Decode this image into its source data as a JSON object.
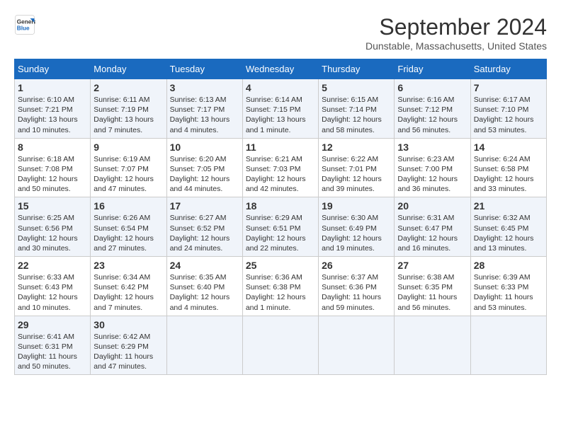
{
  "header": {
    "logo_line1": "General",
    "logo_line2": "Blue",
    "title": "September 2024",
    "subtitle": "Dunstable, Massachusetts, United States"
  },
  "columns": [
    "Sunday",
    "Monday",
    "Tuesday",
    "Wednesday",
    "Thursday",
    "Friday",
    "Saturday"
  ],
  "weeks": [
    [
      {
        "day": "1",
        "sunrise": "Sunrise: 6:10 AM",
        "sunset": "Sunset: 7:21 PM",
        "daylight": "Daylight: 13 hours and 10 minutes."
      },
      {
        "day": "2",
        "sunrise": "Sunrise: 6:11 AM",
        "sunset": "Sunset: 7:19 PM",
        "daylight": "Daylight: 13 hours and 7 minutes."
      },
      {
        "day": "3",
        "sunrise": "Sunrise: 6:13 AM",
        "sunset": "Sunset: 7:17 PM",
        "daylight": "Daylight: 13 hours and 4 minutes."
      },
      {
        "day": "4",
        "sunrise": "Sunrise: 6:14 AM",
        "sunset": "Sunset: 7:15 PM",
        "daylight": "Daylight: 13 hours and 1 minute."
      },
      {
        "day": "5",
        "sunrise": "Sunrise: 6:15 AM",
        "sunset": "Sunset: 7:14 PM",
        "daylight": "Daylight: 12 hours and 58 minutes."
      },
      {
        "day": "6",
        "sunrise": "Sunrise: 6:16 AM",
        "sunset": "Sunset: 7:12 PM",
        "daylight": "Daylight: 12 hours and 56 minutes."
      },
      {
        "day": "7",
        "sunrise": "Sunrise: 6:17 AM",
        "sunset": "Sunset: 7:10 PM",
        "daylight": "Daylight: 12 hours and 53 minutes."
      }
    ],
    [
      {
        "day": "8",
        "sunrise": "Sunrise: 6:18 AM",
        "sunset": "Sunset: 7:08 PM",
        "daylight": "Daylight: 12 hours and 50 minutes."
      },
      {
        "day": "9",
        "sunrise": "Sunrise: 6:19 AM",
        "sunset": "Sunset: 7:07 PM",
        "daylight": "Daylight: 12 hours and 47 minutes."
      },
      {
        "day": "10",
        "sunrise": "Sunrise: 6:20 AM",
        "sunset": "Sunset: 7:05 PM",
        "daylight": "Daylight: 12 hours and 44 minutes."
      },
      {
        "day": "11",
        "sunrise": "Sunrise: 6:21 AM",
        "sunset": "Sunset: 7:03 PM",
        "daylight": "Daylight: 12 hours and 42 minutes."
      },
      {
        "day": "12",
        "sunrise": "Sunrise: 6:22 AM",
        "sunset": "Sunset: 7:01 PM",
        "daylight": "Daylight: 12 hours and 39 minutes."
      },
      {
        "day": "13",
        "sunrise": "Sunrise: 6:23 AM",
        "sunset": "Sunset: 7:00 PM",
        "daylight": "Daylight: 12 hours and 36 minutes."
      },
      {
        "day": "14",
        "sunrise": "Sunrise: 6:24 AM",
        "sunset": "Sunset: 6:58 PM",
        "daylight": "Daylight: 12 hours and 33 minutes."
      }
    ],
    [
      {
        "day": "15",
        "sunrise": "Sunrise: 6:25 AM",
        "sunset": "Sunset: 6:56 PM",
        "daylight": "Daylight: 12 hours and 30 minutes."
      },
      {
        "day": "16",
        "sunrise": "Sunrise: 6:26 AM",
        "sunset": "Sunset: 6:54 PM",
        "daylight": "Daylight: 12 hours and 27 minutes."
      },
      {
        "day": "17",
        "sunrise": "Sunrise: 6:27 AM",
        "sunset": "Sunset: 6:52 PM",
        "daylight": "Daylight: 12 hours and 24 minutes."
      },
      {
        "day": "18",
        "sunrise": "Sunrise: 6:29 AM",
        "sunset": "Sunset: 6:51 PM",
        "daylight": "Daylight: 12 hours and 22 minutes."
      },
      {
        "day": "19",
        "sunrise": "Sunrise: 6:30 AM",
        "sunset": "Sunset: 6:49 PM",
        "daylight": "Daylight: 12 hours and 19 minutes."
      },
      {
        "day": "20",
        "sunrise": "Sunrise: 6:31 AM",
        "sunset": "Sunset: 6:47 PM",
        "daylight": "Daylight: 12 hours and 16 minutes."
      },
      {
        "day": "21",
        "sunrise": "Sunrise: 6:32 AM",
        "sunset": "Sunset: 6:45 PM",
        "daylight": "Daylight: 12 hours and 13 minutes."
      }
    ],
    [
      {
        "day": "22",
        "sunrise": "Sunrise: 6:33 AM",
        "sunset": "Sunset: 6:43 PM",
        "daylight": "Daylight: 12 hours and 10 minutes."
      },
      {
        "day": "23",
        "sunrise": "Sunrise: 6:34 AM",
        "sunset": "Sunset: 6:42 PM",
        "daylight": "Daylight: 12 hours and 7 minutes."
      },
      {
        "day": "24",
        "sunrise": "Sunrise: 6:35 AM",
        "sunset": "Sunset: 6:40 PM",
        "daylight": "Daylight: 12 hours and 4 minutes."
      },
      {
        "day": "25",
        "sunrise": "Sunrise: 6:36 AM",
        "sunset": "Sunset: 6:38 PM",
        "daylight": "Daylight: 12 hours and 1 minute."
      },
      {
        "day": "26",
        "sunrise": "Sunrise: 6:37 AM",
        "sunset": "Sunset: 6:36 PM",
        "daylight": "Daylight: 11 hours and 59 minutes."
      },
      {
        "day": "27",
        "sunrise": "Sunrise: 6:38 AM",
        "sunset": "Sunset: 6:35 PM",
        "daylight": "Daylight: 11 hours and 56 minutes."
      },
      {
        "day": "28",
        "sunrise": "Sunrise: 6:39 AM",
        "sunset": "Sunset: 6:33 PM",
        "daylight": "Daylight: 11 hours and 53 minutes."
      }
    ],
    [
      {
        "day": "29",
        "sunrise": "Sunrise: 6:41 AM",
        "sunset": "Sunset: 6:31 PM",
        "daylight": "Daylight: 11 hours and 50 minutes."
      },
      {
        "day": "30",
        "sunrise": "Sunrise: 6:42 AM",
        "sunset": "Sunset: 6:29 PM",
        "daylight": "Daylight: 11 hours and 47 minutes."
      },
      null,
      null,
      null,
      null,
      null
    ]
  ]
}
